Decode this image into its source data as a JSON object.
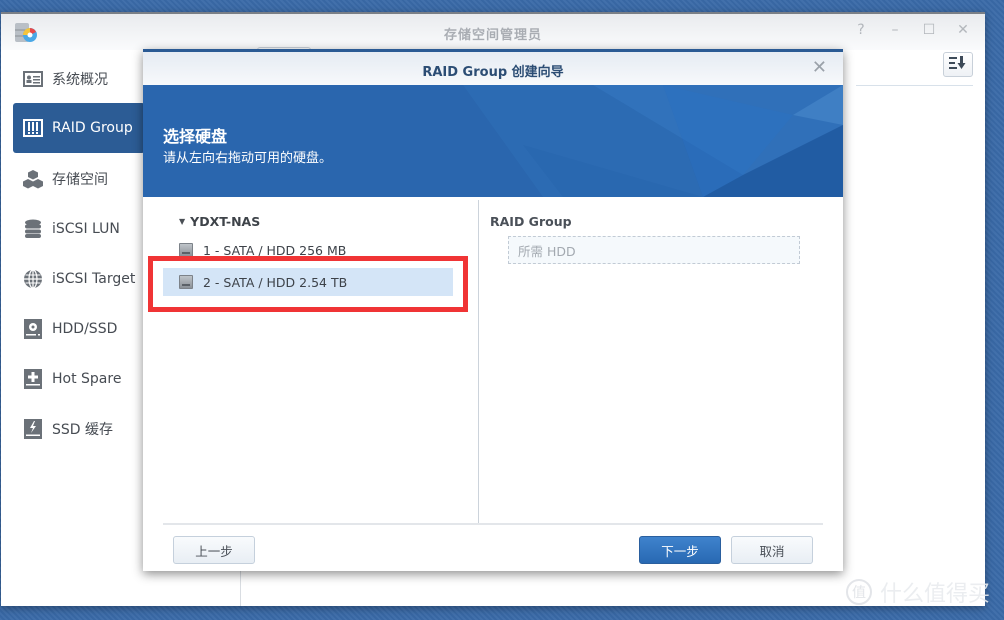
{
  "window": {
    "title": "存储空间管理员",
    "controls": {
      "help": "?",
      "minimize": "–",
      "maximize": "☐",
      "close": "✕"
    }
  },
  "sidebar": {
    "items": [
      {
        "label": "系统概况",
        "icon": "overview-icon",
        "active": false
      },
      {
        "label": "RAID Group",
        "icon": "raid-icon",
        "active": true
      },
      {
        "label": "存储空间",
        "icon": "cubes-icon",
        "active": false
      },
      {
        "label": "iSCSI LUN",
        "icon": "database-icon",
        "active": false
      },
      {
        "label": "iSCSI Target",
        "icon": "globe-icon",
        "active": false
      },
      {
        "label": "HDD/SSD",
        "icon": "hdd-icon",
        "active": false
      },
      {
        "label": "Hot Spare",
        "icon": "hot-spare-icon",
        "active": false
      },
      {
        "label": "SSD 缓存",
        "icon": "ssd-cache-icon",
        "active": false
      }
    ]
  },
  "dialog": {
    "title": "RAID Group 创建向导",
    "close": "✕",
    "banner": {
      "title": "选择硬盘",
      "subtitle": "请从左向右拖动可用的硬盘。"
    },
    "left_pane": {
      "root": "YDXT-NAS",
      "disks": [
        {
          "label": "1 - SATA / HDD 256 MB",
          "selected": false
        },
        {
          "label": "2 - SATA / HDD 2.54 TB",
          "selected": true
        }
      ]
    },
    "right_pane": {
      "label": "RAID Group",
      "placeholder": "所需 HDD"
    },
    "footer": {
      "back": "上一步",
      "next": "下一步",
      "cancel": "取消"
    }
  },
  "colors": {
    "accent": "#2c5c95",
    "highlight": "#f03435",
    "primary_button": "#2f73bf"
  },
  "watermark": {
    "badge": "值",
    "text": "什么值得买"
  }
}
